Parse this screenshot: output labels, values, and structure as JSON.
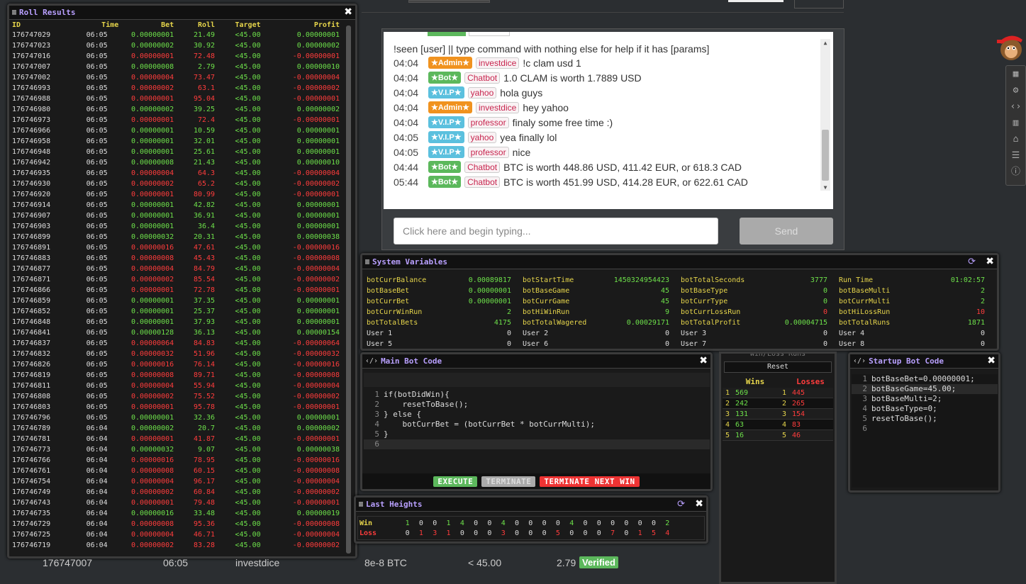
{
  "roll_results": {
    "title": "Roll Results",
    "headers": [
      "ID",
      "Time",
      "Bet",
      "Roll",
      "Target",
      "Profit"
    ],
    "rows": [
      [
        "176747029",
        "06:05",
        "0.00000001",
        "21.49",
        "<45.00",
        "0.00000001",
        "w"
      ],
      [
        "176747023",
        "06:05",
        "0.00000002",
        "30.92",
        "<45.00",
        "0.00000002",
        "w"
      ],
      [
        "176747016",
        "06:05",
        "0.00000001",
        "72.48",
        "<45.00",
        "-0.00000001",
        "l"
      ],
      [
        "176747007",
        "06:05",
        "0.00000008",
        "2.79",
        "<45.00",
        "0.00000010",
        "w"
      ],
      [
        "176747002",
        "06:05",
        "0.00000004",
        "73.47",
        "<45.00",
        "-0.00000004",
        "l"
      ],
      [
        "176746993",
        "06:05",
        "0.00000002",
        "63.1",
        "<45.00",
        "-0.00000002",
        "l"
      ],
      [
        "176746988",
        "06:05",
        "0.00000001",
        "95.04",
        "<45.00",
        "-0.00000001",
        "l"
      ],
      [
        "176746980",
        "06:05",
        "0.00000002",
        "39.25",
        "<45.00",
        "0.00000002",
        "w"
      ],
      [
        "176746973",
        "06:05",
        "0.00000001",
        "72.4",
        "<45.00",
        "-0.00000001",
        "l"
      ],
      [
        "176746966",
        "06:05",
        "0.00000001",
        "10.59",
        "<45.00",
        "0.00000001",
        "w"
      ],
      [
        "176746958",
        "06:05",
        "0.00000001",
        "32.01",
        "<45.00",
        "0.00000001",
        "w"
      ],
      [
        "176746948",
        "06:05",
        "0.00000001",
        "25.61",
        "<45.00",
        "0.00000001",
        "w"
      ],
      [
        "176746942",
        "06:05",
        "0.00000008",
        "21.43",
        "<45.00",
        "0.00000010",
        "w"
      ],
      [
        "176746935",
        "06:05",
        "0.00000004",
        "64.3",
        "<45.00",
        "-0.00000004",
        "l"
      ],
      [
        "176746930",
        "06:05",
        "0.00000002",
        "65.2",
        "<45.00",
        "-0.00000002",
        "l"
      ],
      [
        "176746920",
        "06:05",
        "0.00000001",
        "80.99",
        "<45.00",
        "-0.00000001",
        "l"
      ],
      [
        "176746914",
        "06:05",
        "0.00000001",
        "42.82",
        "<45.00",
        "0.00000001",
        "w"
      ],
      [
        "176746907",
        "06:05",
        "0.00000001",
        "36.91",
        "<45.00",
        "0.00000001",
        "w"
      ],
      [
        "176746903",
        "06:05",
        "0.00000001",
        "36.4",
        "<45.00",
        "0.00000001",
        "w"
      ],
      [
        "176746899",
        "06:05",
        "0.00000032",
        "20.31",
        "<45.00",
        "0.00000038",
        "w"
      ],
      [
        "176746891",
        "06:05",
        "0.00000016",
        "47.61",
        "<45.00",
        "-0.00000016",
        "l"
      ],
      [
        "176746883",
        "06:05",
        "0.00000008",
        "45.43",
        "<45.00",
        "-0.00000008",
        "l"
      ],
      [
        "176746877",
        "06:05",
        "0.00000004",
        "84.79",
        "<45.00",
        "-0.00000004",
        "l"
      ],
      [
        "176746871",
        "06:05",
        "0.00000002",
        "85.54",
        "<45.00",
        "-0.00000002",
        "l"
      ],
      [
        "176746866",
        "06:05",
        "0.00000001",
        "72.78",
        "<45.00",
        "-0.00000001",
        "l"
      ],
      [
        "176746859",
        "06:05",
        "0.00000001",
        "37.35",
        "<45.00",
        "0.00000001",
        "w"
      ],
      [
        "176746852",
        "06:05",
        "0.00000001",
        "25.37",
        "<45.00",
        "0.00000001",
        "w"
      ],
      [
        "176746848",
        "06:05",
        "0.00000001",
        "37.93",
        "<45.00",
        "0.00000001",
        "w"
      ],
      [
        "176746841",
        "06:05",
        "0.00000128",
        "36.13",
        "<45.00",
        "0.00000154",
        "w"
      ],
      [
        "176746837",
        "06:05",
        "0.00000064",
        "84.83",
        "<45.00",
        "-0.00000064",
        "l"
      ],
      [
        "176746832",
        "06:05",
        "0.00000032",
        "51.96",
        "<45.00",
        "-0.00000032",
        "l"
      ],
      [
        "176746826",
        "06:05",
        "0.00000016",
        "76.14",
        "<45.00",
        "-0.00000016",
        "l"
      ],
      [
        "176746819",
        "06:05",
        "0.00000008",
        "89.71",
        "<45.00",
        "-0.00000008",
        "l"
      ],
      [
        "176746811",
        "06:05",
        "0.00000004",
        "55.94",
        "<45.00",
        "-0.00000004",
        "l"
      ],
      [
        "176746808",
        "06:05",
        "0.00000002",
        "75.52",
        "<45.00",
        "-0.00000002",
        "l"
      ],
      [
        "176746803",
        "06:05",
        "0.00000001",
        "95.78",
        "<45.00",
        "-0.00000001",
        "l"
      ],
      [
        "176746796",
        "06:05",
        "0.00000001",
        "32.36",
        "<45.00",
        "0.00000001",
        "w"
      ],
      [
        "176746789",
        "06:04",
        "0.00000002",
        "20.7",
        "<45.00",
        "0.00000002",
        "w"
      ],
      [
        "176746781",
        "06:04",
        "0.00000001",
        "41.87",
        "<45.00",
        "-0.00000001",
        "l"
      ],
      [
        "176746773",
        "06:04",
        "0.00000032",
        "9.07",
        "<45.00",
        "0.00000038",
        "w"
      ],
      [
        "176746766",
        "06:04",
        "0.00000016",
        "78.95",
        "<45.00",
        "-0.00000016",
        "l"
      ],
      [
        "176746761",
        "06:04",
        "0.00000008",
        "60.15",
        "<45.00",
        "-0.00000008",
        "l"
      ],
      [
        "176746754",
        "06:04",
        "0.00000004",
        "96.17",
        "<45.00",
        "-0.00000004",
        "l"
      ],
      [
        "176746749",
        "06:04",
        "0.00000002",
        "60.84",
        "<45.00",
        "-0.00000002",
        "l"
      ],
      [
        "176746743",
        "06:04",
        "0.00000001",
        "79.48",
        "<45.00",
        "-0.00000001",
        "l"
      ],
      [
        "176746735",
        "06:04",
        "0.00000016",
        "33.48",
        "<45.00",
        "0.00000019",
        "w"
      ],
      [
        "176746729",
        "06:04",
        "0.00000008",
        "95.36",
        "<45.00",
        "-0.00000008",
        "l"
      ],
      [
        "176746725",
        "06:04",
        "0.00000004",
        "46.71",
        "<45.00",
        "-0.00000004",
        "l"
      ],
      [
        "176746719",
        "06:04",
        "0.00000002",
        "83.28",
        "<45.00",
        "-0.00000002",
        "l"
      ]
    ]
  },
  "chat": {
    "top_line": "!seen [user] || type command with nothing else for help if it has [params]",
    "messages": [
      {
        "time": "04:04",
        "badge": "★Admin★",
        "role": "admin",
        "user": "investdice",
        "text": "!c clam usd 1"
      },
      {
        "time": "04:04",
        "badge": "★Bot★",
        "role": "bot",
        "user": "Chatbot",
        "text": "1.0 CLAM is worth 1.7889 USD"
      },
      {
        "time": "04:04",
        "badge": "★V.I.P★",
        "role": "vip",
        "user": "yahoo",
        "text": "hola guys"
      },
      {
        "time": "04:04",
        "badge": "★Admin★",
        "role": "admin",
        "user": "investdice",
        "text": "hey yahoo"
      },
      {
        "time": "04:04",
        "badge": "★V.I.P★",
        "role": "vip",
        "user": "professor",
        "text": "finaly some free time :)"
      },
      {
        "time": "04:05",
        "badge": "★V.I.P★",
        "role": "vip",
        "user": "yahoo",
        "text": "yea finally lol"
      },
      {
        "time": "04:05",
        "badge": "★V.I.P★",
        "role": "vip",
        "user": "professor",
        "text": "nice"
      },
      {
        "time": "04:44",
        "badge": "★Bot★",
        "role": "bot",
        "user": "Chatbot",
        "text": "BTC is worth 448.86 USD, 411.42 EUR, or 618.3 CAD"
      },
      {
        "time": "05:44",
        "badge": "★Bot★",
        "role": "bot",
        "user": "Chatbot",
        "text": "BTC is worth 451.99 USD, 414.28 EUR, or 622.61 CAD"
      }
    ],
    "input_placeholder": "Click here and begin typing...",
    "send_label": "Send"
  },
  "system_variables": {
    "title": "System Variables",
    "cells": [
      [
        "botCurrBalance",
        "0.00089817",
        "r0"
      ],
      [
        "botStartTime",
        "1450324954423",
        "r0"
      ],
      [
        "botTotalSeconds",
        "3777",
        "r0"
      ],
      [
        "Run Time",
        "01:02:57",
        "r0"
      ],
      [
        "botBaseBet",
        "0.00000001",
        "r0"
      ],
      [
        "botBaseGame",
        "45",
        "r0"
      ],
      [
        "botBaseType",
        "0",
        "r0"
      ],
      [
        "botBaseMulti",
        "2",
        "r0"
      ],
      [
        "botCurrBet",
        "0.00000001",
        "r0"
      ],
      [
        "botCurrGame",
        "45",
        "r0"
      ],
      [
        "botCurrType",
        "0",
        "r0"
      ],
      [
        "botCurrMulti",
        "2",
        "r0"
      ],
      [
        "botCurrWinRun",
        "2",
        "r0"
      ],
      [
        "botHiWinRun",
        "9",
        "r0"
      ],
      [
        "botCurrLossRun",
        "0",
        "red"
      ],
      [
        "botHiLossRun",
        "10",
        "red"
      ],
      [
        "botTotalBets",
        "4175",
        "r0"
      ],
      [
        "botTotalWagered",
        "0.00029171",
        "r0"
      ],
      [
        "botTotalProfit",
        "0.00004715",
        "r0"
      ],
      [
        "botTotalRuns",
        "1871",
        "r0"
      ],
      [
        "User 1",
        "0",
        "w"
      ],
      [
        "User 2",
        "0",
        "w"
      ],
      [
        "User 3",
        "0",
        "w"
      ],
      [
        "User 4",
        "0",
        "w"
      ],
      [
        "User 5",
        "0",
        "w"
      ],
      [
        "User 6",
        "0",
        "w"
      ],
      [
        "User 7",
        "0",
        "w"
      ],
      [
        "User 8",
        "0",
        "w"
      ]
    ]
  },
  "main_bot_code": {
    "title": "Main Bot Code",
    "lines": [
      "if(botDidWin){",
      "    resetToBase();",
      "} else {",
      "    botCurrBet = (botCurrBet * botCurrMulti);",
      "}",
      ""
    ],
    "execute": "EXECUTE",
    "terminate": "TERMINATE",
    "terminate_next_win": "TERMINATE NEXT WIN"
  },
  "win_loss": {
    "title": "Win/Loss Runs",
    "reset": "Reset",
    "wins_label": "Wins",
    "losses_label": "Losses",
    "rows": [
      [
        "1",
        "569",
        "1",
        "445"
      ],
      [
        "2",
        "242",
        "2",
        "265"
      ],
      [
        "3",
        "131",
        "3",
        "154"
      ],
      [
        "4",
        "63",
        "4",
        "83"
      ],
      [
        "5",
        "16",
        "5",
        "46"
      ]
    ]
  },
  "startup_bot_code": {
    "title": "Startup Bot Code",
    "lines": [
      "botBaseBet=0.00000001;",
      "botBaseGame=45.00;",
      "botBaseMulti=2;",
      "botBaseType=0;",
      "resetToBase();",
      ""
    ]
  },
  "last_heights": {
    "title": "Last Heights",
    "win_label": "Win",
    "loss_label": "Loss",
    "win": [
      "1",
      "0",
      "0",
      "1",
      "4",
      "0",
      "0",
      "4",
      "0",
      "0",
      "0",
      "0",
      "4",
      "0",
      "0",
      "0",
      "0",
      "0",
      "0",
      "2"
    ],
    "loss": [
      "0",
      "1",
      "3",
      "1",
      "0",
      "0",
      "0",
      "3",
      "0",
      "0",
      "0",
      "5",
      "0",
      "0",
      "0",
      "7",
      "0",
      "1",
      "5",
      "4"
    ]
  },
  "below": {
    "id": "176747007",
    "time": "06:05",
    "user": "investdice",
    "bet": "8e-8 BTC",
    "target": "< 45.00",
    "roll": "2.79",
    "verified": "Verified"
  }
}
